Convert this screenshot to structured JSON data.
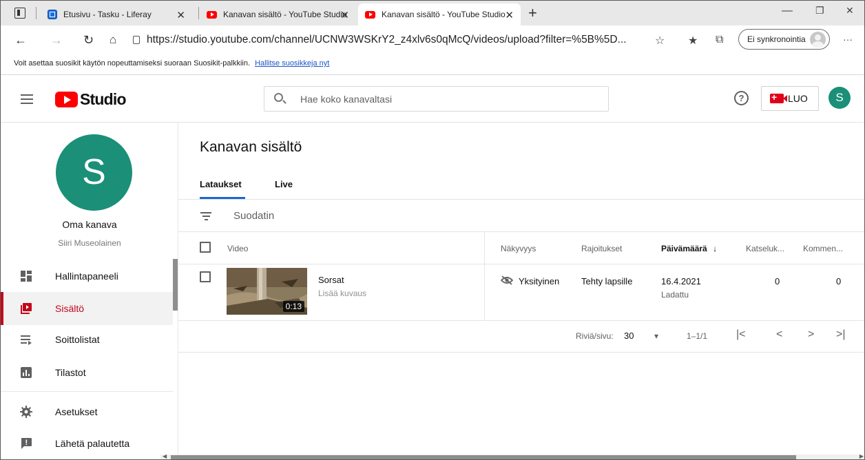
{
  "browser": {
    "tabs": [
      {
        "title": "Etusivu - Tasku - Liferay",
        "icon": "liferay-icon"
      },
      {
        "title": "Kanavan sisältö - YouTube Studio",
        "icon": "youtube-icon"
      },
      {
        "title": "Kanavan sisältö - YouTube Studio",
        "icon": "youtube-icon"
      }
    ],
    "tab_close": "✕",
    "new_tab": "+",
    "url": "https://studio.youtube.com/channel/UCNW3WSKrY2_z4xlv6s0qMcQ/videos/upload?filter=%5B%5D...",
    "sync_label": "Ei synkronointia",
    "more": "···",
    "favorites_bar_text": "Voit asettaa suosikit käytön nopeuttamiseksi suoraan Suosikit-palkkiin.",
    "favorites_link": "Hallitse suosikkeja nyt",
    "win_minimize": "—",
    "win_restore": "❐",
    "win_close": "✕"
  },
  "header": {
    "logo_text": "Studio",
    "search_placeholder": "Hae koko kanavaltasi",
    "help": "?",
    "create_label": "LUO",
    "avatar_letter": "S"
  },
  "sidebar": {
    "avatar_letter": "S",
    "channel_label": "Oma kanava",
    "channel_name": "Siiri Museolainen",
    "items": [
      {
        "label": "Hallintapaneeli",
        "icon": "dashboard-icon"
      },
      {
        "label": "Sisältö",
        "icon": "content-icon",
        "active": true
      },
      {
        "label": "Soittolistat",
        "icon": "playlists-icon"
      },
      {
        "label": "Tilastot",
        "icon": "analytics-icon"
      },
      {
        "label": "Asetukset",
        "icon": "settings-icon"
      },
      {
        "label": "Lähetä palautetta",
        "icon": "feedback-icon"
      }
    ]
  },
  "main": {
    "title": "Kanavan sisältö",
    "tabs": [
      {
        "label": "Lataukset",
        "active": true
      },
      {
        "label": "Live"
      }
    ],
    "filter_label": "Suodatin",
    "columns": {
      "video": "Video",
      "visibility": "Näkyvyys",
      "restrictions": "Rajoitukset",
      "date": "Päivämäärä",
      "date_sort": "↓",
      "views": "Katseluk...",
      "comments": "Kommen..."
    },
    "rows": [
      {
        "title": "Sorsat",
        "description": "Lisää kuvaus",
        "duration": "0:13",
        "visibility": "Yksityinen",
        "restrictions": "Tehty lapsille",
        "date": "16.4.2021",
        "date_status": "Ladattu",
        "views": "0",
        "comments": "0"
      }
    ],
    "pagination": {
      "rows_label": "Riviä/sivu:",
      "rows_value": "30",
      "range": "1–1/1",
      "first": "|<",
      "prev": "<",
      "next": ">",
      "last": ">|"
    }
  },
  "colors": {
    "accent_red": "#c4061a",
    "avatar_green": "#1b8f78",
    "tab_blue": "#1b67d1"
  }
}
